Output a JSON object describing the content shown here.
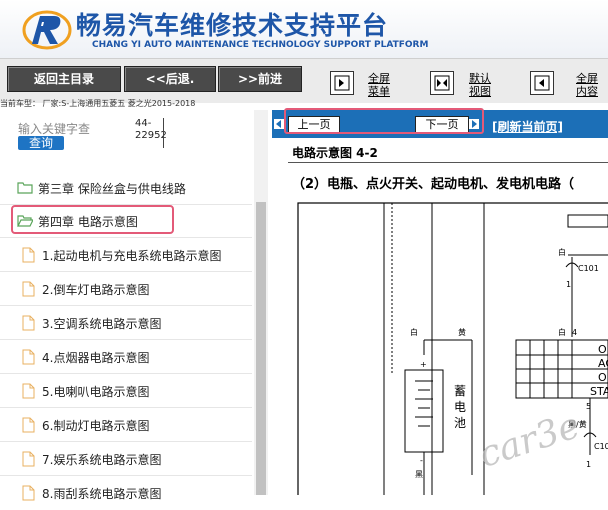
{
  "header": {
    "title": "畅易汽车维修技术支持平台",
    "subtitle": "CHANG YI AUTO MAINTENANCE TECHNOLOGY SUPPORT PLATFORM",
    "brand_color": "#1e56a8"
  },
  "toolbar": {
    "home_label": "返回主目录",
    "back_label": "<<后退.",
    "forward_label": ">>前进",
    "fullscreen_menu": [
      "全屏",
      "菜单"
    ],
    "default_view": [
      "默认",
      "视图"
    ],
    "fullscreen_content": [
      "全屏",
      "内容"
    ]
  },
  "vehicle_info": "当前车型： 厂家:S-上海通用五菱五 菱之光2015-2018",
  "search": {
    "placeholder": "输入关键字查",
    "button_label": "查询",
    "code_line1": "44-",
    "code_line2": "22952"
  },
  "tree": {
    "chapter3": "第三章 保险丝盒与供电线路",
    "chapter4": "第四章 电路示意图",
    "items": [
      "1.起动电机与充电系统电路示意图",
      "2.倒车灯电路示意图",
      "3.空调系统电路示意图",
      "4.点烟器电路示意图",
      "5.电喇叭电路示意图",
      "6.制动灯电路示意图",
      "7.娱乐系统电路示意图",
      "8.雨刮系统电路示意图"
    ]
  },
  "nav": {
    "prev_label": "上一页",
    "next_label": "下一页",
    "refresh_label": "[刷新当前页]",
    "bar_color": "#1c6fb7"
  },
  "diagram": {
    "title": "电路示意图 4-2",
    "subtitle": "（2）电瓶、点火开关、起动电机、发电机电路（",
    "labels": {
      "white1": "白",
      "c101": "C101",
      "one1": "1",
      "white2": "白",
      "yellow1": "黄",
      "white3": "白",
      "c1_4": "4",
      "plus": "+",
      "battery_chars": [
        "蓄",
        "电",
        "池"
      ],
      "minus": "-",
      "black": "黑",
      "sw1": "O",
      "sw2": "AC",
      "sw3": "O",
      "sw4": "STA",
      "five": "5",
      "black_yellow": "黑/黄",
      "c10x": "C10",
      "one2": "1"
    }
  },
  "watermark": "car3e"
}
